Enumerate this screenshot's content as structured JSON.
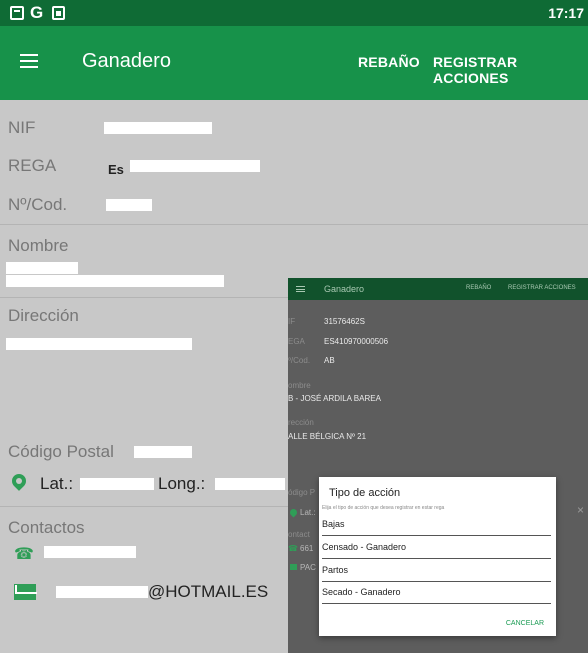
{
  "statusbar": {
    "carrier_glyph": "G",
    "time": "17:17"
  },
  "toolbar": {
    "title": "Ganadero",
    "rebano_label": "REBAÑO",
    "registrar_label": "REGISTRAR ACCIONES"
  },
  "fields": {
    "nif_label": "NIF",
    "rega_label": "REGA",
    "rega_value_partial": "Es",
    "cod_label": "Nº/Cod.",
    "nombre_label": "Nombre",
    "direccion_label": "Dirección",
    "cp_label": "Código Postal",
    "lat_label": "Lat.:",
    "long_label": "Long.:",
    "contactos_label": "Contactos",
    "email_suffix": "@HOTMAIL.ES"
  },
  "inset": {
    "title": "Ganadero",
    "rebano_label": "REBAÑO",
    "registrar_label": "REGISTRAR ACCIONES",
    "nif_label": "IF",
    "nif_value": "31576462S",
    "rega_label": "EGA",
    "rega_value": "ES410970000506",
    "cod_label": "º/Cod.",
    "cod_value": "AB",
    "nombre_label": "ombre",
    "nombre_value": "B - JOSÉ ARDILA BAREA",
    "direccion_label": "rección",
    "direccion_value": "ALLE BÉLGICA Nº 21",
    "cp_label": "ódigo P",
    "lat_label": "Lat.:",
    "contactos_label": "ontact",
    "phone_partial": "661",
    "email_partial": "PAC",
    "close_glyph": "×"
  },
  "dialog": {
    "title": "Tipo de acción",
    "subtitle": "Elija el tipo de acción que desea registrar en estar rega",
    "options": [
      "Bajas",
      "Censado - Ganadero",
      "Partos",
      "Secado - Ganadero"
    ],
    "cancel_label": "CANCELAR"
  },
  "colors": {
    "status_green": "#0f6b35",
    "toolbar_green": "#17924a",
    "accent_green": "#2f9e57"
  }
}
